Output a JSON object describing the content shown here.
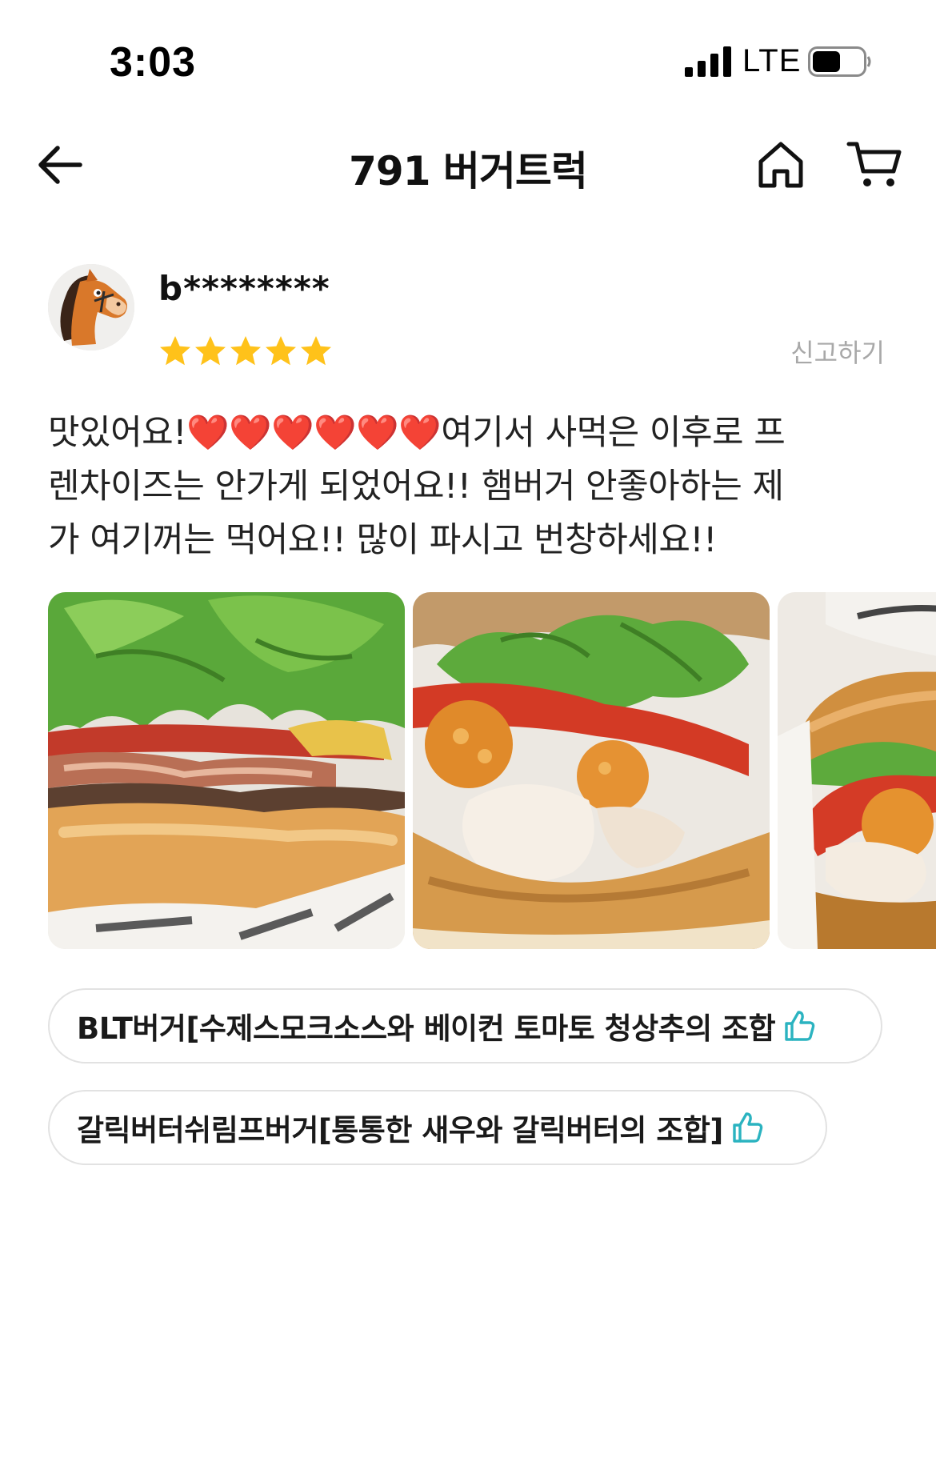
{
  "status_bar": {
    "time": "3:03",
    "network": "LTE",
    "icons": [
      "signal-bars-icon",
      "battery-icon"
    ]
  },
  "nav": {
    "title": "791 버거트럭",
    "icons": [
      "back-arrow-icon",
      "home-icon",
      "cart-icon"
    ]
  },
  "review": {
    "reviewer_name": "b********",
    "rating": 5,
    "rating_max": 5,
    "star_color": "#FFC21A",
    "report_label": "신고하기",
    "text": "맛있어요!❤️❤️❤️❤️❤️❤️여기서 사먹은 이후로 프\n렌차이즈는 안가게 되었어요!!  햄버거 안좋아하는 제\n가 여기꺼는 먹어요!! 많이 파시고 번창하세요!!",
    "photos": [
      "burger-photo-blt",
      "burger-photo-shrimp",
      "burger-photo-shrimp-2"
    ]
  },
  "menu_chips": [
    {
      "label": "BLT버거[수제스모크소스와 베이컨 토마토 청상추의 조합",
      "icon": "thumbs-up-icon"
    },
    {
      "label": "갈릭버터쉬림프버거[통통한 새우와 갈릭버터의 조합]",
      "icon": "thumbs-up-icon"
    }
  ],
  "colors": {
    "accent": "#2BB3C0",
    "heart": "#E8202A",
    "chip_border": "#E2E2E2",
    "muted_text": "#A8A8A8"
  }
}
